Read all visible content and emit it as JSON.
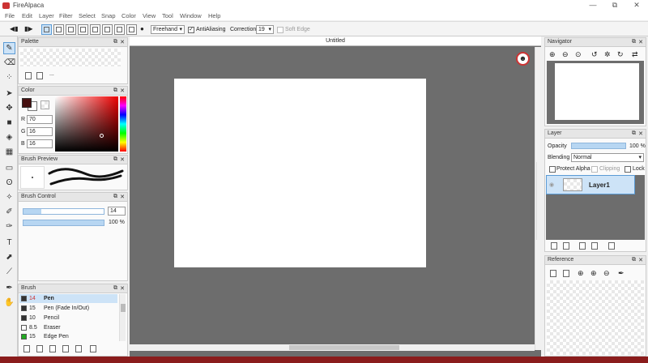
{
  "app": {
    "title": "FireAlpaca",
    "doc_title": "Untitled"
  },
  "window_buttons": {
    "minimize": "—",
    "maximize": "⧉",
    "close": "✕"
  },
  "menu": [
    "File",
    "Edit",
    "Layer",
    "Filter",
    "Select",
    "Snap",
    "Color",
    "View",
    "Tool",
    "Window",
    "Help"
  ],
  "toolbar": {
    "stroke_mode": "Freehand",
    "antialiasing_label": "AntiAliasing",
    "antialiasing_checked": true,
    "correction_label": "Correction",
    "correction_value": "19",
    "soft_edge_label": "Soft Edge",
    "soft_edge_checked": false
  },
  "panels": {
    "palette": "Palette",
    "color": "Color",
    "brush_preview": "Brush Preview",
    "brush_control": "Brush Control",
    "brush": "Brush",
    "navigator": "Navigator",
    "layer": "Layer",
    "reference": "Reference"
  },
  "palette": {
    "more": "..."
  },
  "color": {
    "r_label": "R",
    "r": "70",
    "g_label": "G",
    "g": "16",
    "b_label": "B",
    "b": "16",
    "primary": "#461010",
    "secondary": "#ffffff"
  },
  "brush_control": {
    "size": "14",
    "size_fraction": 0.22,
    "opacity": "100 %",
    "opacity_fraction": 1.0
  },
  "brushes": [
    {
      "size": "14",
      "name": "Pen",
      "color": "#333333",
      "active": true
    },
    {
      "size": "15",
      "name": "Pen (Fade In/Out)",
      "color": "#333333",
      "active": false
    },
    {
      "size": "10",
      "name": "Pencil",
      "color": "#333333",
      "active": false
    },
    {
      "size": "8.5",
      "name": "Eraser",
      "color": "#ffffff",
      "active": false
    },
    {
      "size": "15",
      "name": "Edge Pen",
      "color": "#22aa22",
      "active": false
    }
  ],
  "layer": {
    "opacity_label": "Opacity",
    "opacity": "100 %",
    "blending_label": "Blending",
    "blending": "Normal",
    "protect_alpha": "Protect Alpha",
    "clipping": "Clipping",
    "lock": "Lock",
    "layers": [
      {
        "name": "Layer1",
        "active": true
      }
    ]
  }
}
